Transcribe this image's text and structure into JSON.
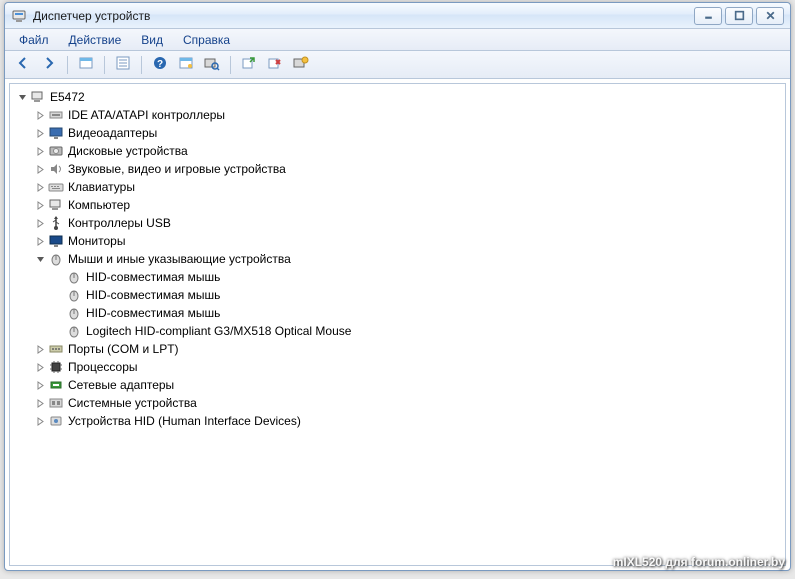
{
  "window": {
    "title": "Диспетчер устройств"
  },
  "menu": {
    "file": "Файл",
    "action": "Действие",
    "view": "Вид",
    "help": "Справка"
  },
  "toolbar_icons": {
    "back": "back-icon",
    "forward": "forward-icon",
    "show_hidden": "show-icon",
    "list": "list-icon",
    "help": "help-icon",
    "devices": "devices-icon",
    "scan": "scan-icon",
    "update": "update-icon",
    "uninstall": "uninstall-icon",
    "properties": "properties-icon"
  },
  "tree": {
    "root": "E5472",
    "categories": [
      {
        "label": "IDE ATA/ATAPI контроллеры",
        "icon": "ide"
      },
      {
        "label": "Видеоадаптеры",
        "icon": "display"
      },
      {
        "label": "Дисковые устройства",
        "icon": "disk"
      },
      {
        "label": "Звуковые, видео и игровые устройства",
        "icon": "sound"
      },
      {
        "label": "Клавиатуры",
        "icon": "keyboard"
      },
      {
        "label": "Компьютер",
        "icon": "computer"
      },
      {
        "label": "Контроллеры USB",
        "icon": "usb"
      },
      {
        "label": "Мониторы",
        "icon": "monitor"
      },
      {
        "label": "Мыши и иные указывающие устройства",
        "icon": "mouse",
        "expanded": true,
        "children": [
          {
            "label": "HID-совместимая мышь",
            "icon": "mouse"
          },
          {
            "label": "HID-совместимая мышь",
            "icon": "mouse"
          },
          {
            "label": "HID-совместимая мышь",
            "icon": "mouse"
          },
          {
            "label": "Logitech HID-compliant G3/MX518 Optical Mouse",
            "icon": "mouse"
          }
        ]
      },
      {
        "label": "Порты (COM и LPT)",
        "icon": "port"
      },
      {
        "label": "Процессоры",
        "icon": "cpu"
      },
      {
        "label": "Сетевые адаптеры",
        "icon": "network"
      },
      {
        "label": "Системные устройства",
        "icon": "system"
      },
      {
        "label": "Устройства HID (Human Interface Devices)",
        "icon": "hid"
      }
    ]
  },
  "watermark": "mIXL520 для forum.onliner.by"
}
